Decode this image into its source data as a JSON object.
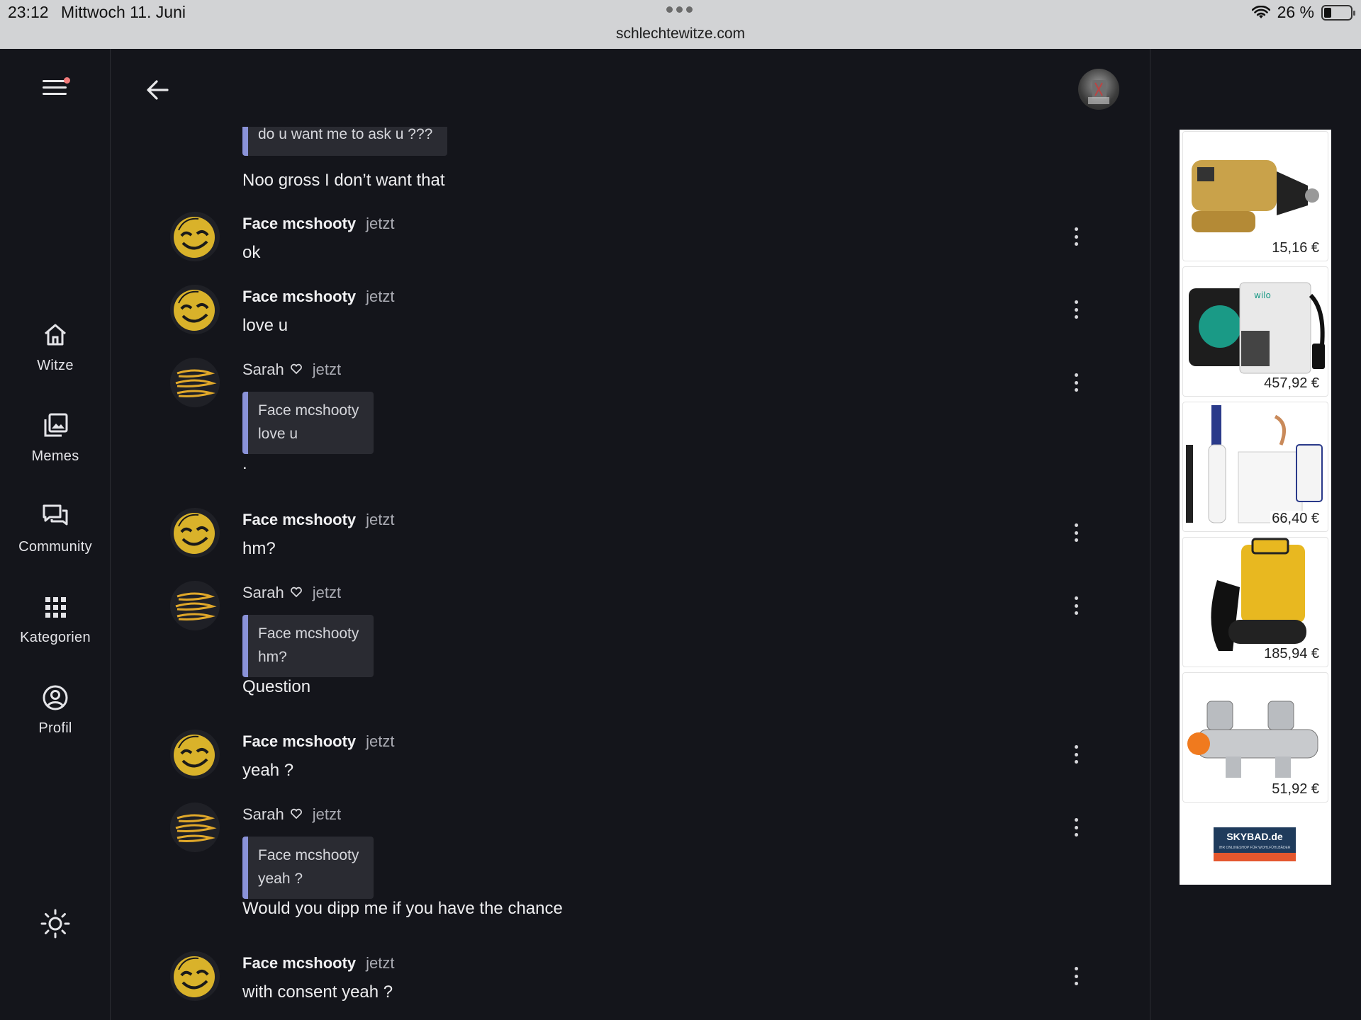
{
  "status": {
    "time": "23:12",
    "date": "Mittwoch 11. Juni",
    "url": "schlechtewitze.com",
    "battery": "26 %"
  },
  "nav": {
    "items": [
      {
        "label": "Witze",
        "icon": "home-icon"
      },
      {
        "label": "Memes",
        "icon": "image-gallery-icon"
      },
      {
        "label": "Community",
        "icon": "chat-bubbles-icon"
      },
      {
        "label": "Kategorien",
        "icon": "grid-icon"
      },
      {
        "label": "Profil",
        "icon": "user-circle-icon"
      }
    ],
    "theme_icon": "sun-icon",
    "menu_icon": "hamburger-menu-icon"
  },
  "header": {
    "back_icon": "arrow-left-icon"
  },
  "chat": {
    "top_quote": "do u want me to ask u ???",
    "top_reply": "Noo gross I don’t want that",
    "messages": [
      {
        "author": "Face mcshooty",
        "time": "jetzt",
        "text": "ok"
      },
      {
        "author": "Face mcshooty",
        "time": "jetzt",
        "text": "love u"
      },
      {
        "author": "Sarah",
        "time": "jetzt",
        "quote_author": "Face mcshooty",
        "quote_text": "love u",
        "text": "."
      },
      {
        "author": "Face mcshooty",
        "time": "jetzt",
        "text": "hm?"
      },
      {
        "author": "Sarah",
        "time": "jetzt",
        "quote_author": "Face mcshooty",
        "quote_text": "hm?",
        "text": "Question"
      },
      {
        "author": "Face mcshooty",
        "time": "jetzt",
        "text": "yeah ?"
      },
      {
        "author": "Sarah",
        "time": "jetzt",
        "quote_author": "Face mcshooty",
        "quote_text": "yeah ?",
        "text": "Would you dipp me if you have the chance"
      },
      {
        "author": "Face mcshooty",
        "time": "jetzt",
        "text": "with consent yeah ?"
      }
    ]
  },
  "ad": {
    "prices": [
      "15,16 €",
      "457,92 €",
      "66,40 €",
      "185,94 €",
      "51,92 €"
    ],
    "brand_main": "SKYBAD.de",
    "brand_sub": "IHR ONLINESHOP FÜR WOHLFÜHLBÄDER",
    "tile_brand": "wilo"
  }
}
